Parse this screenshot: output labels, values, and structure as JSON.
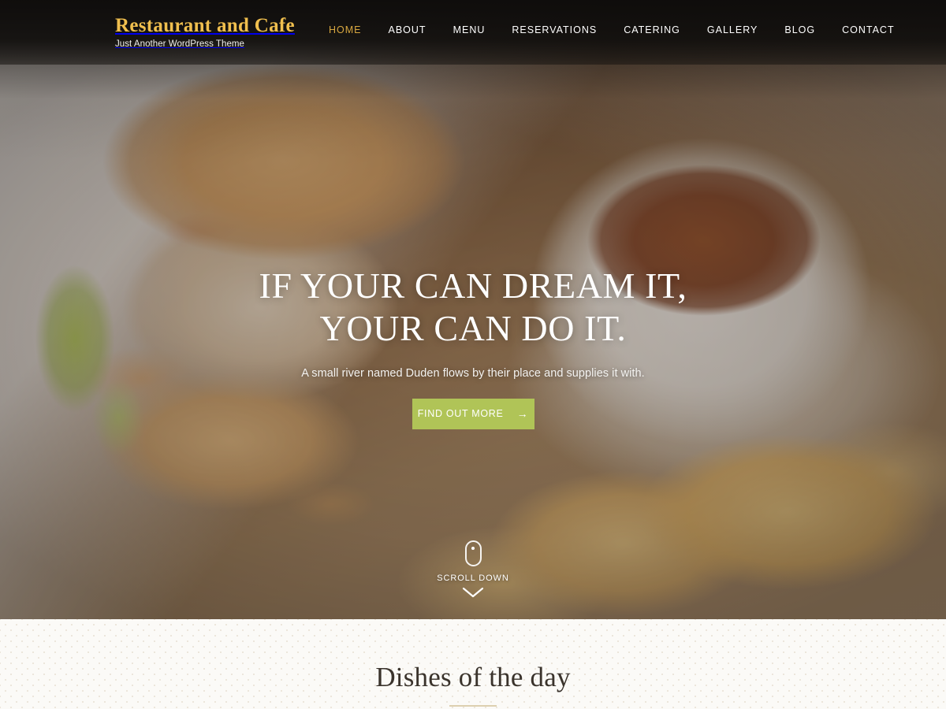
{
  "header": {
    "brand_title": "Restaurant and Cafe",
    "brand_tagline": "Just Another WordPress Theme",
    "nav": [
      {
        "label": "HOME",
        "active": true
      },
      {
        "label": "ABOUT",
        "active": false
      },
      {
        "label": "MENU",
        "active": false
      },
      {
        "label": "RESERVATIONS",
        "active": false
      },
      {
        "label": "CATERING",
        "active": false
      },
      {
        "label": "GALLERY",
        "active": false
      },
      {
        "label": "BLOG",
        "active": false
      },
      {
        "label": "CONTACT",
        "active": false
      }
    ]
  },
  "hero": {
    "title_line1": "IF YOUR CAN DREAM IT,",
    "title_line2": "YOUR CAN DO IT.",
    "subtitle": "A small river named Duden flows by their place and supplies it with.",
    "cta_label": "FIND OUT MORE",
    "cta_arrow": "→",
    "scroll_label": "SCROLL DOWN"
  },
  "sections": {
    "dishes_title": "Dishes of the day"
  },
  "colors": {
    "brand_gold": "#f0bf4e",
    "nav_active": "#d8a740",
    "cta_green": "#b0c457",
    "header_bg": "#0e0c0b",
    "section_bg": "#fbfaf7",
    "divider_gold": "#ddd0b0",
    "heading_dark": "#3a332c"
  },
  "icons": {
    "mouse": "mouse-icon",
    "chevron_down": "chevron-down-icon",
    "arrow_right": "arrow-right-icon"
  }
}
